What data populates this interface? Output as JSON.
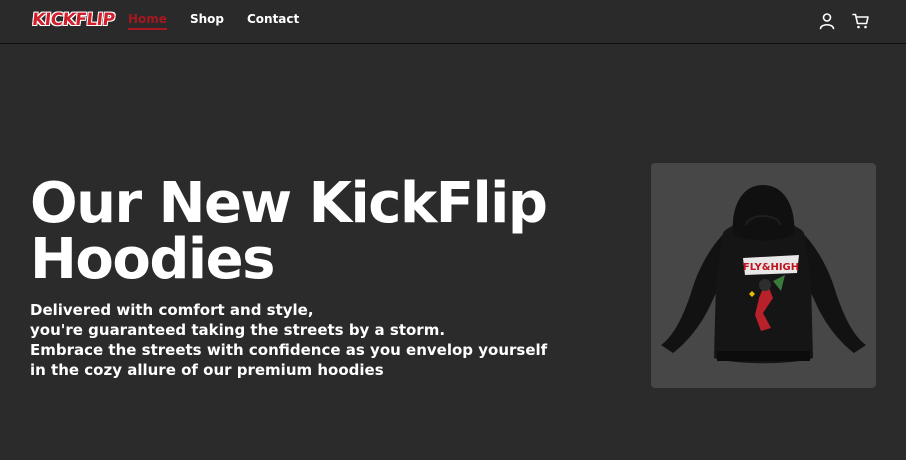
{
  "brand": {
    "logo_text": "KICKFLIP"
  },
  "nav": {
    "links": [
      {
        "label": "Home",
        "active": true
      },
      {
        "label": "Shop",
        "active": false
      },
      {
        "label": "Contact",
        "active": false
      }
    ],
    "icons": [
      "user-icon",
      "cart-icon"
    ],
    "active_color": "#a51820"
  },
  "hero": {
    "title_line1": "Our New KickFlip",
    "title_line2": "Hoodies",
    "desc_line1": "Delivered with comfort and style,",
    "desc_line2": "you're guaranteed taking the streets by a storm.",
    "desc_line3": "Embrace the streets with confidence as you envelop yourself",
    "desc_line4": "in the cozy allure of our premium hoodies"
  },
  "product": {
    "graphic_text": "FLY&HIGH",
    "hoodie_color": "#111111",
    "card_bg": "#474747"
  },
  "colors": {
    "background": "#2b2b2b",
    "brand_red": "#d01f2a",
    "text": "#ffffff"
  }
}
